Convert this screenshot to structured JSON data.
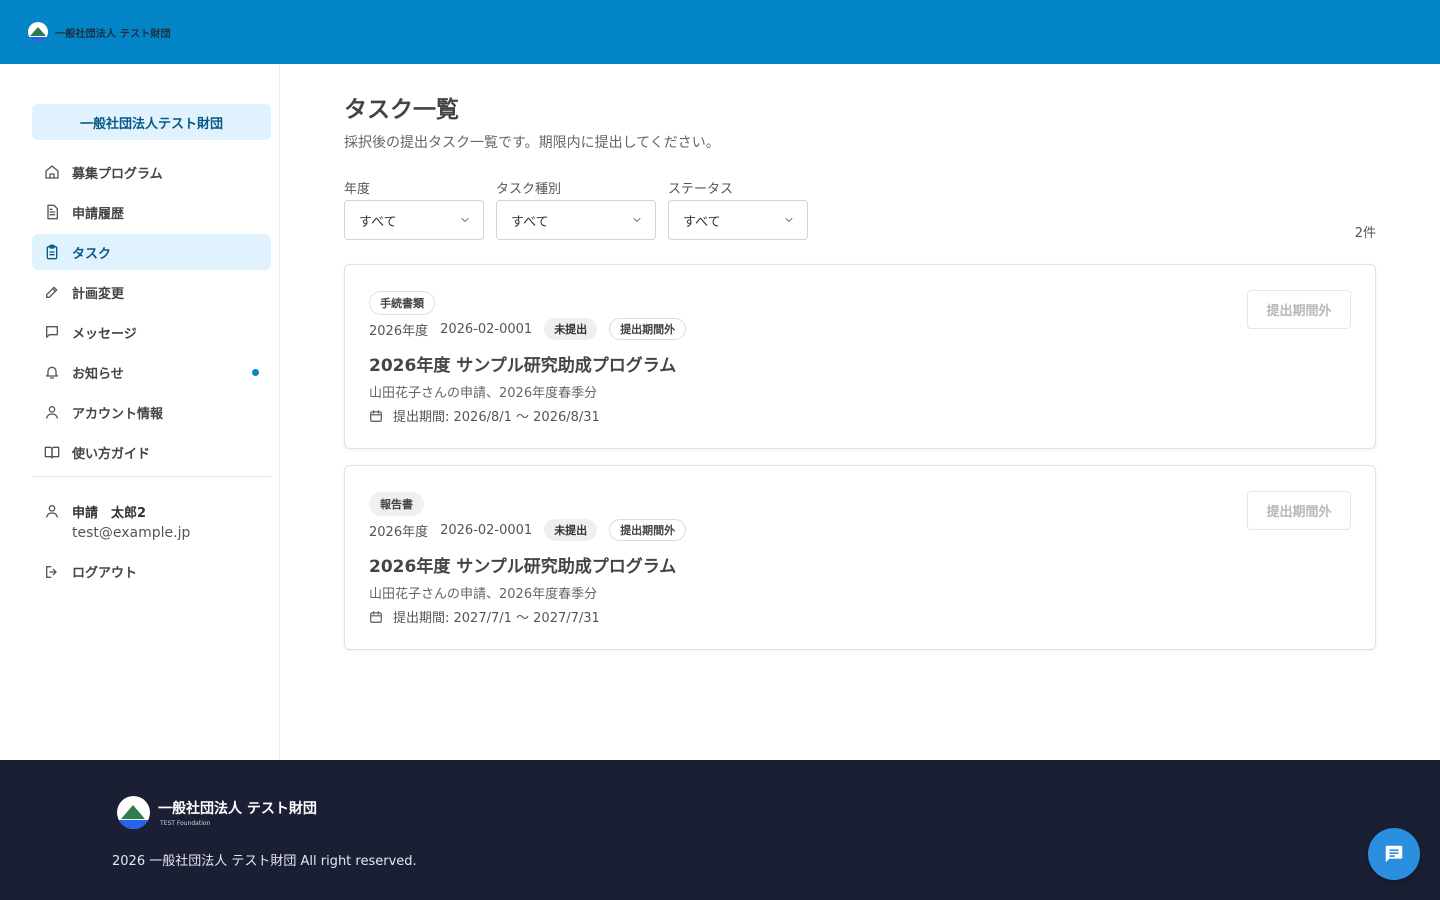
{
  "header": {
    "brand": "一般社団法人 テスト財団"
  },
  "sidebar": {
    "org_name": "一般社団法人テスト財団",
    "items": [
      {
        "label": "募集プログラム",
        "icon": "home-icon"
      },
      {
        "label": "申請履歴",
        "icon": "document-icon"
      },
      {
        "label": "タスク",
        "icon": "clipboard-icon",
        "active": true
      },
      {
        "label": "計画変更",
        "icon": "pencil-icon"
      },
      {
        "label": "メッセージ",
        "icon": "message-icon"
      },
      {
        "label": "お知らせ",
        "icon": "bell-icon",
        "has_dot": true
      },
      {
        "label": "アカウント情報",
        "icon": "user-icon"
      },
      {
        "label": "使い方ガイド",
        "icon": "book-icon"
      }
    ],
    "user": {
      "name": "申請　太郎2",
      "email": "test@example.jp"
    },
    "logout_label": "ログアウト"
  },
  "main": {
    "title": "タスク一覧",
    "description": "採択後の提出タスク一覧です。期限内に提出してください。",
    "filters": [
      {
        "label": "年度",
        "value": "すべて"
      },
      {
        "label": "タスク種別",
        "value": "すべて"
      },
      {
        "label": "ステータス",
        "value": "すべて"
      }
    ],
    "count": "2件",
    "tasks": [
      {
        "type_tag": "手続書類",
        "year": "2026年度",
        "app_id": "2026-02-0001",
        "status": "未提出",
        "period_status": "提出期間外",
        "title": "2026年度 サンプル研究助成プログラム",
        "subtitle": "山田花子さんの申請、2026年度春季分",
        "period": "提出期間: 2026/8/1 〜 2026/8/31",
        "action_label": "提出期間外"
      },
      {
        "type_tag": "報告書",
        "year": "2026年度",
        "app_id": "2026-02-0001",
        "status": "未提出",
        "period_status": "提出期間外",
        "title": "2026年度 サンプル研究助成プログラム",
        "subtitle": "山田花子さんの申請、2026年度春季分",
        "period": "提出期間: 2027/7/1 〜 2027/7/31",
        "action_label": "提出期間外"
      }
    ]
  },
  "footer": {
    "org_name": "一般社団法人 テスト財団",
    "org_sub": "TEST Foundation",
    "copyright": "2026 一般社団法人 テスト財団 All right reserved."
  },
  "colors": {
    "primary": "#0284c7",
    "footer_bg": "#1b1f33",
    "active_bg": "#e0f2fe",
    "fab": "#2b8fe0"
  }
}
